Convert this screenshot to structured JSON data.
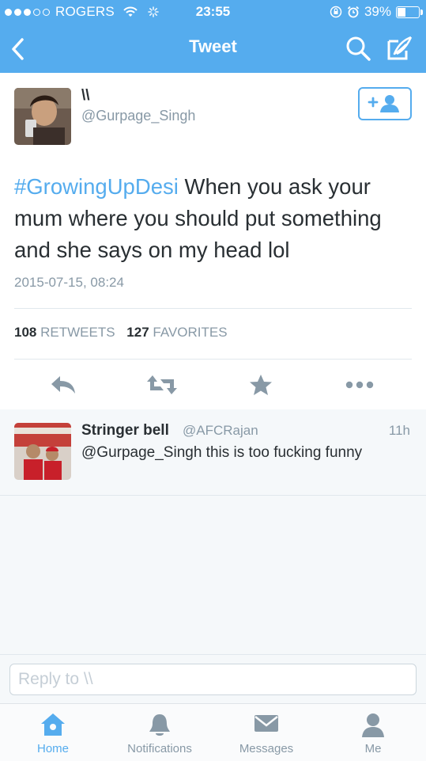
{
  "status_bar": {
    "carrier": "ROGERS",
    "time": "23:55",
    "battery": "39%",
    "battery_level": 0.39
  },
  "nav": {
    "title": "Tweet"
  },
  "tweet": {
    "name": "\\\\",
    "handle": "@Gurpage_Singh",
    "hashtag": "#GrowingUpDesi",
    "text": " When you ask your mum where you should put something and she says on my head lol",
    "timestamp": "2015-07-15, 08:24",
    "retweets_count": "108",
    "retweets_label": "RETWEETS",
    "favorites_count": "127",
    "favorites_label": "FAVORITES"
  },
  "reply": {
    "name": "Stringer bell",
    "handle": "@AFCRajan",
    "time": "11h",
    "text": "@Gurpage_Singh this is too fucking funny"
  },
  "reply_box": {
    "placeholder": "Reply to \\\\"
  },
  "tabs": [
    {
      "label": "Home",
      "icon": "home-icon",
      "active": true
    },
    {
      "label": "Notifications",
      "icon": "bell-icon",
      "active": false
    },
    {
      "label": "Messages",
      "icon": "envelope-icon",
      "active": false
    },
    {
      "label": "Me",
      "icon": "person-icon",
      "active": false
    }
  ],
  "colors": {
    "accent": "#55acee",
    "text": "#292f33",
    "muted": "#8899a6",
    "icon": "#8899a6"
  }
}
